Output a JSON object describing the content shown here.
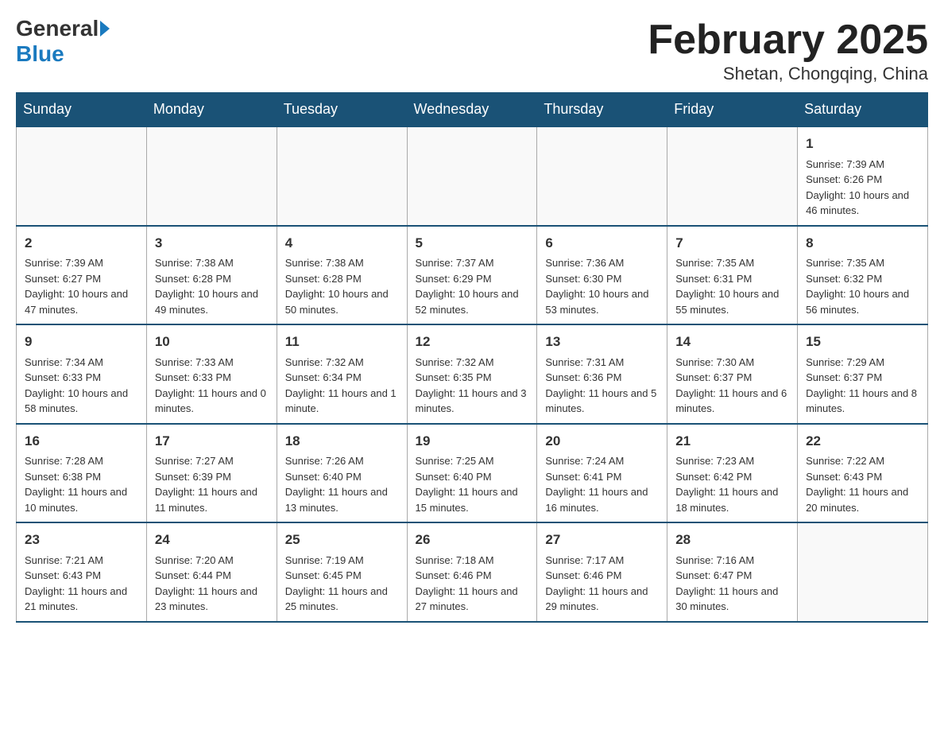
{
  "header": {
    "logo_general": "General",
    "logo_blue": "Blue",
    "month_year": "February 2025",
    "location": "Shetan, Chongqing, China"
  },
  "days_of_week": [
    "Sunday",
    "Monday",
    "Tuesday",
    "Wednesday",
    "Thursday",
    "Friday",
    "Saturday"
  ],
  "weeks": [
    {
      "days": [
        {
          "number": "",
          "info": ""
        },
        {
          "number": "",
          "info": ""
        },
        {
          "number": "",
          "info": ""
        },
        {
          "number": "",
          "info": ""
        },
        {
          "number": "",
          "info": ""
        },
        {
          "number": "",
          "info": ""
        },
        {
          "number": "1",
          "info": "Sunrise: 7:39 AM\nSunset: 6:26 PM\nDaylight: 10 hours and 46 minutes."
        }
      ]
    },
    {
      "days": [
        {
          "number": "2",
          "info": "Sunrise: 7:39 AM\nSunset: 6:27 PM\nDaylight: 10 hours and 47 minutes."
        },
        {
          "number": "3",
          "info": "Sunrise: 7:38 AM\nSunset: 6:28 PM\nDaylight: 10 hours and 49 minutes."
        },
        {
          "number": "4",
          "info": "Sunrise: 7:38 AM\nSunset: 6:28 PM\nDaylight: 10 hours and 50 minutes."
        },
        {
          "number": "5",
          "info": "Sunrise: 7:37 AM\nSunset: 6:29 PM\nDaylight: 10 hours and 52 minutes."
        },
        {
          "number": "6",
          "info": "Sunrise: 7:36 AM\nSunset: 6:30 PM\nDaylight: 10 hours and 53 minutes."
        },
        {
          "number": "7",
          "info": "Sunrise: 7:35 AM\nSunset: 6:31 PM\nDaylight: 10 hours and 55 minutes."
        },
        {
          "number": "8",
          "info": "Sunrise: 7:35 AM\nSunset: 6:32 PM\nDaylight: 10 hours and 56 minutes."
        }
      ]
    },
    {
      "days": [
        {
          "number": "9",
          "info": "Sunrise: 7:34 AM\nSunset: 6:33 PM\nDaylight: 10 hours and 58 minutes."
        },
        {
          "number": "10",
          "info": "Sunrise: 7:33 AM\nSunset: 6:33 PM\nDaylight: 11 hours and 0 minutes."
        },
        {
          "number": "11",
          "info": "Sunrise: 7:32 AM\nSunset: 6:34 PM\nDaylight: 11 hours and 1 minute."
        },
        {
          "number": "12",
          "info": "Sunrise: 7:32 AM\nSunset: 6:35 PM\nDaylight: 11 hours and 3 minutes."
        },
        {
          "number": "13",
          "info": "Sunrise: 7:31 AM\nSunset: 6:36 PM\nDaylight: 11 hours and 5 minutes."
        },
        {
          "number": "14",
          "info": "Sunrise: 7:30 AM\nSunset: 6:37 PM\nDaylight: 11 hours and 6 minutes."
        },
        {
          "number": "15",
          "info": "Sunrise: 7:29 AM\nSunset: 6:37 PM\nDaylight: 11 hours and 8 minutes."
        }
      ]
    },
    {
      "days": [
        {
          "number": "16",
          "info": "Sunrise: 7:28 AM\nSunset: 6:38 PM\nDaylight: 11 hours and 10 minutes."
        },
        {
          "number": "17",
          "info": "Sunrise: 7:27 AM\nSunset: 6:39 PM\nDaylight: 11 hours and 11 minutes."
        },
        {
          "number": "18",
          "info": "Sunrise: 7:26 AM\nSunset: 6:40 PM\nDaylight: 11 hours and 13 minutes."
        },
        {
          "number": "19",
          "info": "Sunrise: 7:25 AM\nSunset: 6:40 PM\nDaylight: 11 hours and 15 minutes."
        },
        {
          "number": "20",
          "info": "Sunrise: 7:24 AM\nSunset: 6:41 PM\nDaylight: 11 hours and 16 minutes."
        },
        {
          "number": "21",
          "info": "Sunrise: 7:23 AM\nSunset: 6:42 PM\nDaylight: 11 hours and 18 minutes."
        },
        {
          "number": "22",
          "info": "Sunrise: 7:22 AM\nSunset: 6:43 PM\nDaylight: 11 hours and 20 minutes."
        }
      ]
    },
    {
      "days": [
        {
          "number": "23",
          "info": "Sunrise: 7:21 AM\nSunset: 6:43 PM\nDaylight: 11 hours and 21 minutes."
        },
        {
          "number": "24",
          "info": "Sunrise: 7:20 AM\nSunset: 6:44 PM\nDaylight: 11 hours and 23 minutes."
        },
        {
          "number": "25",
          "info": "Sunrise: 7:19 AM\nSunset: 6:45 PM\nDaylight: 11 hours and 25 minutes."
        },
        {
          "number": "26",
          "info": "Sunrise: 7:18 AM\nSunset: 6:46 PM\nDaylight: 11 hours and 27 minutes."
        },
        {
          "number": "27",
          "info": "Sunrise: 7:17 AM\nSunset: 6:46 PM\nDaylight: 11 hours and 29 minutes."
        },
        {
          "number": "28",
          "info": "Sunrise: 7:16 AM\nSunset: 6:47 PM\nDaylight: 11 hours and 30 minutes."
        },
        {
          "number": "",
          "info": ""
        }
      ]
    }
  ]
}
